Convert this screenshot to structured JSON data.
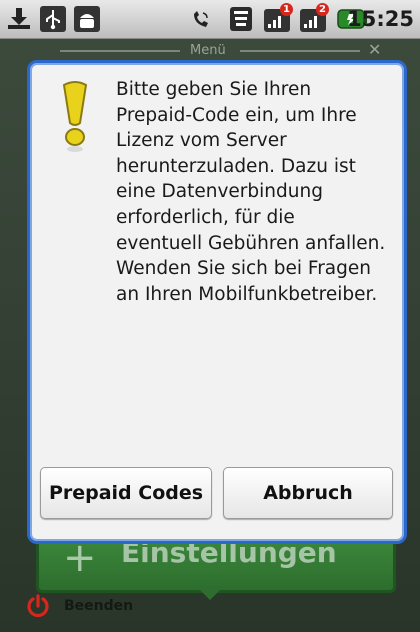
{
  "status_bar": {
    "time": "15:25",
    "notification_badge_1": "1",
    "notification_badge_2": "2",
    "icons": [
      "download-icon",
      "usb-icon",
      "android-icon",
      "phone-icon",
      "wifi-icon",
      "signal-icon-1",
      "signal-icon-2",
      "battery-icon"
    ]
  },
  "background": {
    "menu_label": "Menü",
    "settings_label": "Einstellungen",
    "quit_label": "Beenden"
  },
  "dialog": {
    "message": "Bitte geben Sie Ihren Prepaid-Code ein, um Ihre Lizenz vom Server herunterzuladen. Dazu ist eine Datenverbindung erforderlich, für die eventuell Gebühren anfallen. Wenden Sie sich bei Fragen an Ihren Mobilfunkbetreiber.",
    "prepaid_button": "Prepaid Codes",
    "cancel_button": "Abbruch"
  },
  "colors": {
    "dialog_border": "#2b68c9",
    "warning_yellow": "#e8d21c",
    "settings_green": "#2d6d2d",
    "quit_red": "#d9261c"
  }
}
